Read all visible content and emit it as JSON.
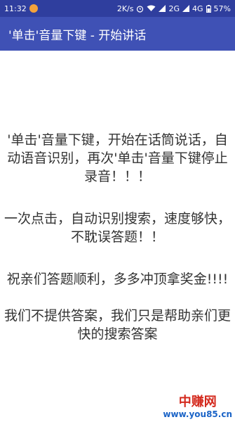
{
  "status_bar": {
    "time": "11:32",
    "speed": "2K/s",
    "network_1": "2G",
    "network_2": "4G",
    "battery": "57%"
  },
  "app_bar": {
    "title": "'单击'音量下键 - 开始讲话"
  },
  "content": {
    "paragraph_1": "'单击'音量下键，开始在话筒说话，自动语音识别，再次'单击'音量下键停止录音！！！",
    "paragraph_2": "一次点击，自动识别搜索，速度够快，不耽误答题！！",
    "paragraph_3": "祝亲们答题顺利，多多冲顶拿奖金!!!!",
    "paragraph_4": "我们不提供答案，我们只是帮助亲们更快的搜索答案"
  },
  "watermark": {
    "title": "中赚网",
    "url": "www.you85.cn"
  },
  "colors": {
    "status_bar": "#2f3e9e",
    "app_bar": "#3f51b5",
    "text": "#333333"
  }
}
